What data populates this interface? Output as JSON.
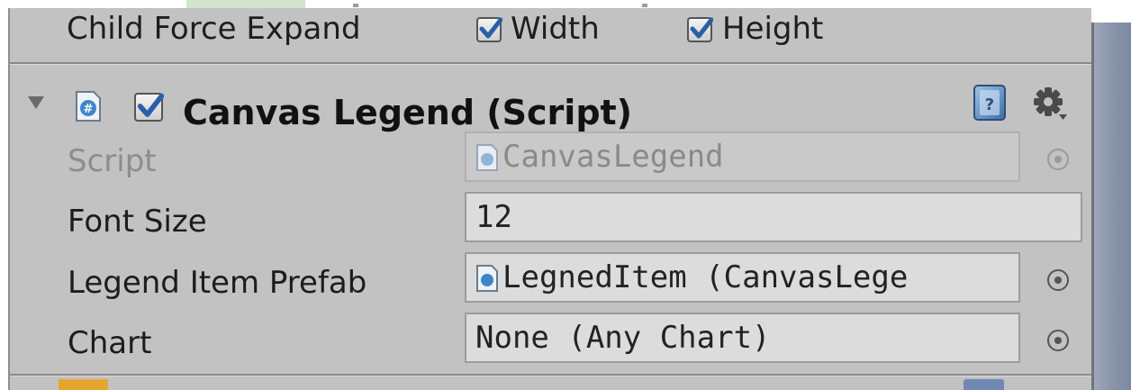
{
  "child_force_expand": {
    "label": "Child Force Expand",
    "width": {
      "label": "Width",
      "checked": true
    },
    "height": {
      "label": "Height",
      "checked": true
    }
  },
  "component": {
    "enabled": true,
    "title": "Canvas Legend (Script)",
    "icon": "csharp-script-icon"
  },
  "fields": {
    "script": {
      "label": "Script",
      "value": "CanvasLegend"
    },
    "font_size": {
      "label": "Font Size",
      "value": "12"
    },
    "legend_item_prefab": {
      "label": "Legend Item Prefab",
      "value": "LegnedItem (CanvasLege"
    },
    "chart": {
      "label": "Chart",
      "value": "None (Any Chart)"
    }
  },
  "colors": {
    "panel": "#c2c2c2",
    "field": "#dcdcdc",
    "checkbox_tick": "#2a5ea8",
    "scrollbar": "#8793a9"
  }
}
